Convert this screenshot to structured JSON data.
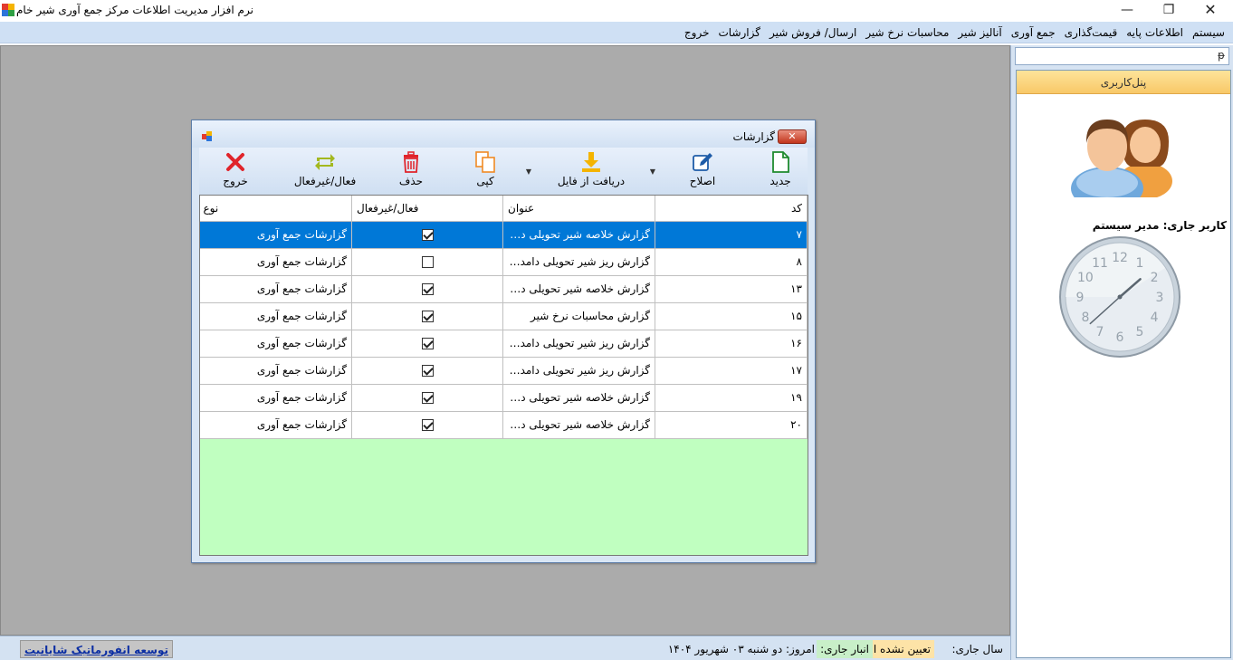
{
  "window": {
    "title": "نرم افزار مدیریت اطلاعات مرکز جمع آوری شیر خام",
    "minimize_glyph": "—",
    "maximize_glyph": "❐",
    "close_glyph": "✕"
  },
  "menu": {
    "items": [
      {
        "label": "سیستم"
      },
      {
        "label": "اطلاعات پایه"
      },
      {
        "label": "قیمت‌گذاری"
      },
      {
        "label": "جمع آوری"
      },
      {
        "label": "آنالیز شیر"
      },
      {
        "label": "محاسبات نرخ شیر"
      },
      {
        "label": "ارسال/ فروش شیر"
      },
      {
        "label": "گزارشات"
      },
      {
        "label": "خروج"
      }
    ]
  },
  "right_panel": {
    "pin_glyph": "ᵽ",
    "header": "پنل‌کاربری",
    "current_user": "کاربر جاری: مدیر سیستم",
    "clock": {
      "hour": 1,
      "minute": 38,
      "numbers": [
        "12",
        "1",
        "2",
        "3",
        "4",
        "5",
        "6",
        "7",
        "8",
        "9",
        "10",
        "11"
      ]
    }
  },
  "statusbar": {
    "year_label": "سال جاری:",
    "year_value": "تعیین نشده است",
    "store_label": "انبار جاری:",
    "date": "امروز: دو شنبه ۰۳ شهریور ۱۴۰۴",
    "developer": "توسعه انفورماتیک شایانیت"
  },
  "child_window": {
    "title": "گزارشات",
    "close_glyph": "✕",
    "toolbar": {
      "new": "جدید",
      "edit": "اصلاح",
      "import": "دریافت از فایل",
      "copy": "کپی",
      "delete": "حذف",
      "toggle": "فعال/غیرفعال",
      "exit": "خروج"
    },
    "grid": {
      "columns": {
        "code": "کد",
        "title": "عنوان",
        "active": "فعال/غیرفعال",
        "type": "نوع"
      },
      "rows": [
        {
          "code": "۷",
          "title": "گزارش خلاصه شیر تحویلی دا...",
          "active": true,
          "type": "گزارشات جمع آوری"
        },
        {
          "code": "۸",
          "title": "گزارش ریز شیر تحویلی دامدا...",
          "active": false,
          "type": "گزارشات جمع آوری"
        },
        {
          "code": "۱۳",
          "title": "گزارش خلاصه شیر تحویلی دا...",
          "active": true,
          "type": "گزارشات جمع آوری"
        },
        {
          "code": "۱۵",
          "title": "گزارش محاسبات نرخ شیر",
          "active": true,
          "type": "گزارشات جمع آوری"
        },
        {
          "code": "۱۶",
          "title": "گزارش ریز شیر تحویلی دامدا...",
          "active": true,
          "type": "گزارشات جمع آوری"
        },
        {
          "code": "۱۷",
          "title": "گزارش ریز شیر تحویلی دامدا...",
          "active": true,
          "type": "گزارشات جمع آوری"
        },
        {
          "code": "۱۹",
          "title": "گزارش خلاصه شیر تحویلی دا...",
          "active": true,
          "type": "گزارشات جمع آوری"
        },
        {
          "code": "۲۰",
          "title": "گزارش خلاصه شیر تحویلی دا...",
          "active": true,
          "type": "گزارشات جمع آوری"
        }
      ],
      "selected_index": 0
    }
  }
}
